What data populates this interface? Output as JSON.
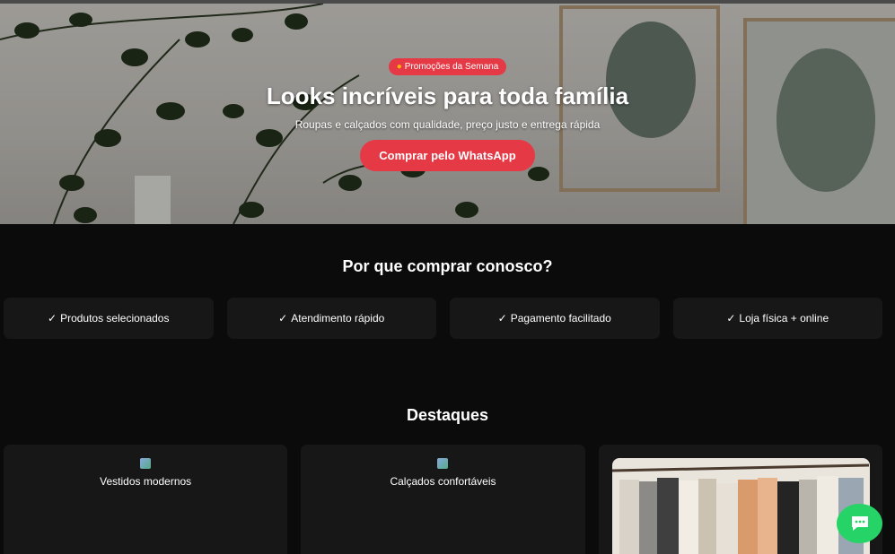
{
  "hero": {
    "badge_icon": "fire-icon",
    "badge": "Promoções da Semana",
    "title": "Looks incríveis para toda família",
    "subtitle": "Roupas e calçados com qualidade, preço justo e entrega rápida",
    "cta": "Comprar pelo WhatsApp"
  },
  "why": {
    "title": "Por que comprar conosco?",
    "check": "✓",
    "items": [
      "Produtos selecionados",
      "Atendimento rápido",
      "Pagamento facilitado",
      "Loja física + online"
    ]
  },
  "highlights": {
    "title": "Destaques",
    "cards": [
      {
        "label": "Vestidos modernos"
      },
      {
        "label": "Calçados confortáveis"
      },
      {
        "label": ""
      }
    ]
  },
  "colors": {
    "accent": "#e63946",
    "whatsapp": "#25d366",
    "background": "#0b0b0b",
    "card": "#171717"
  },
  "fab": {
    "icon": "chat-icon"
  }
}
